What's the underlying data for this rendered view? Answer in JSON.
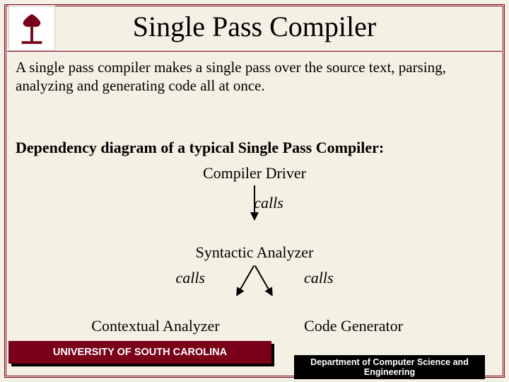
{
  "title": "Single Pass Compiler",
  "intro": "A single pass compiler makes a single pass over the source text, parsing, analyzing and generating code all at once.",
  "subhead": "Dependency diagram of a typical Single Pass Compiler:",
  "diagram": {
    "driver": "Compiler Driver",
    "calls1": "calls",
    "syntactic": "Syntactic Analyzer",
    "calls_left": "calls",
    "calls_right": "calls",
    "contextual": "Contextual Analyzer",
    "codegen": "Code Generator"
  },
  "footer": {
    "university": "UNIVERSITY OF SOUTH CAROLINA",
    "department": "Department of Computer Science and Engineering"
  },
  "colors": {
    "garnet": "#7a0019",
    "bg": "#f4f0e3"
  },
  "logo_name": "usc-palmetto-logo"
}
